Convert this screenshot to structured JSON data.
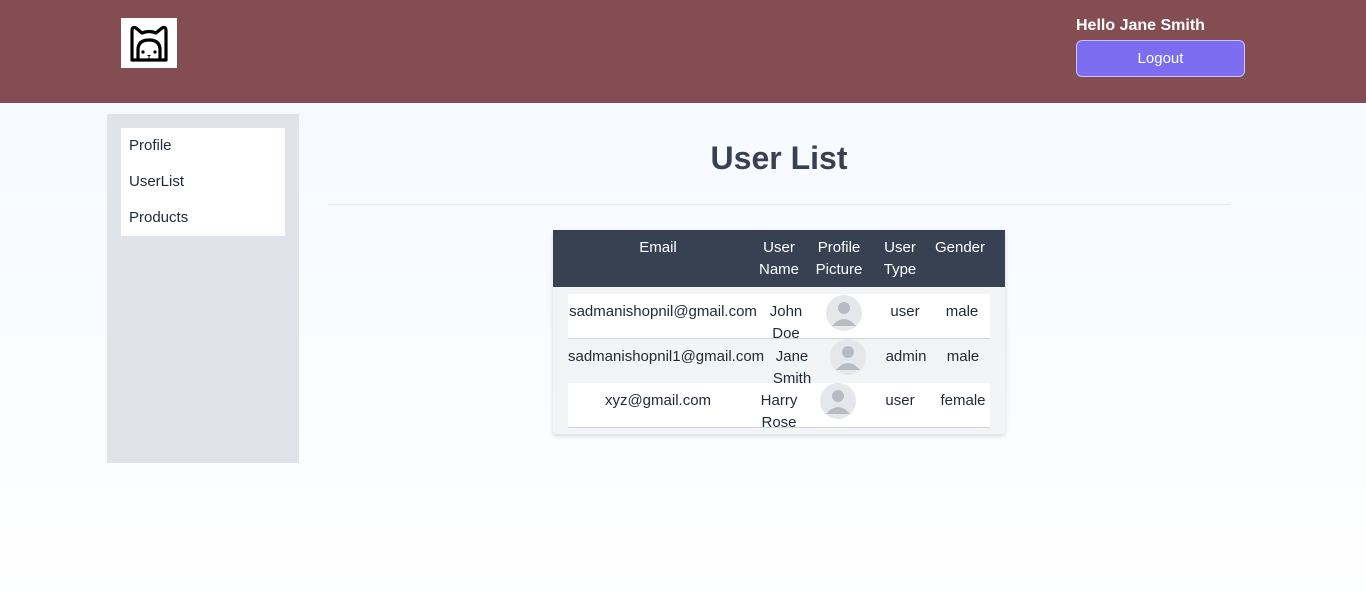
{
  "header": {
    "greeting": "Hello Jane Smith",
    "logout_label": "Logout",
    "background": "#834d51",
    "button_color": "#7b6cf0"
  },
  "sidebar": {
    "items": [
      {
        "label": "Profile"
      },
      {
        "label": "UserList"
      },
      {
        "label": "Products"
      }
    ]
  },
  "main": {
    "title": "User List",
    "table": {
      "columns": [
        "Email",
        "User Name",
        "Profile Picture",
        "User Type",
        "Gender"
      ],
      "rows": [
        {
          "email": "sadmanishopnil@gmail.com",
          "name": "John Doe",
          "picture": "avatar-placeholder-icon",
          "type": "user",
          "gender": "male"
        },
        {
          "email": "sadmanishopnil1@gmail.com",
          "name": "Jane Smith",
          "picture": "avatar-placeholder-icon",
          "type": "admin",
          "gender": "male"
        },
        {
          "email": "xyz@gmail.com",
          "name": "Harry Rose",
          "picture": "avatar-placeholder-icon",
          "type": "user",
          "gender": "female"
        }
      ]
    }
  }
}
